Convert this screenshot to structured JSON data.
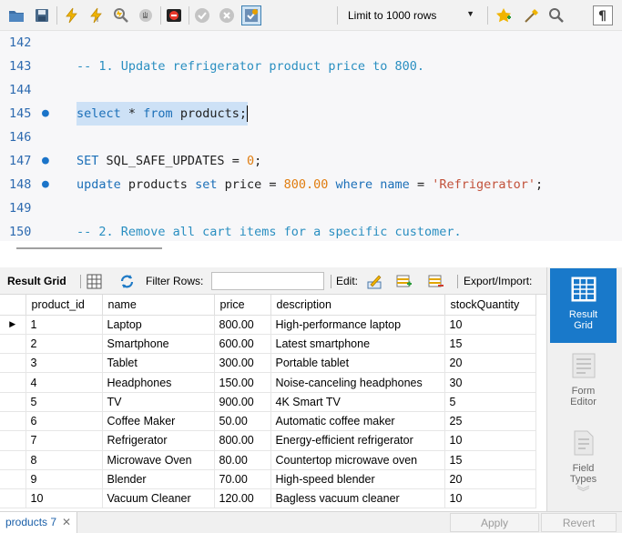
{
  "toolbar": {
    "icons": [
      "open-folder-icon",
      "save-icon",
      "execute-icon",
      "execute-selection-icon",
      "explain-icon",
      "stop-icon",
      "toggle-error-icon",
      "commit-icon",
      "rollback-icon",
      "autocommit-icon",
      "add-snippet-icon",
      "beautify-icon",
      "find-icon",
      "invisible-chars-icon"
    ],
    "limit_label": "Limit to 1000 rows"
  },
  "editor": {
    "lines": [
      {
        "num": "142",
        "dot": false,
        "html_parts": []
      },
      {
        "num": "143",
        "dot": false,
        "comment": "-- 1. Update refrigerator product price to 800."
      },
      {
        "num": "144",
        "dot": false
      },
      {
        "num": "145",
        "dot": true,
        "kw1": "select",
        "op": " * ",
        "kw2": "from",
        "rest": " products;"
      },
      {
        "num": "146",
        "dot": false
      },
      {
        "num": "147",
        "dot": true,
        "kw1": "SET",
        "rest": " SQL_SAFE_UPDATES = ",
        "num_val": "0",
        "end": ";"
      },
      {
        "num": "148",
        "dot": true,
        "kw1": "update",
        "t1": " products ",
        "kw2": "set",
        "t2": " price = ",
        "num_val": "800.00",
        "kw3": " where ",
        "kw4": "name",
        "t3": " = ",
        "str_val": "'Refrigerator'",
        "end": ";"
      },
      {
        "num": "149",
        "dot": false
      },
      {
        "num": "150",
        "dot": false,
        "comment": "-- 2. Remove all cart items for a specific customer."
      }
    ]
  },
  "results_toolbar": {
    "tab_label": "Result Grid",
    "filter_label": "Filter Rows:",
    "filter_value": "",
    "edit_label": "Edit:",
    "export_label": "Export/Import:"
  },
  "grid": {
    "columns": [
      "product_id",
      "name",
      "price",
      "description",
      "stockQuantity"
    ],
    "rows": [
      [
        "1",
        "Laptop",
        "800.00",
        "High-performance laptop",
        "10"
      ],
      [
        "2",
        "Smartphone",
        "600.00",
        "Latest smartphone",
        "15"
      ],
      [
        "3",
        "Tablet",
        "300.00",
        "Portable tablet",
        "20"
      ],
      [
        "4",
        "Headphones",
        "150.00",
        "Noise-canceling headphones",
        "30"
      ],
      [
        "5",
        "TV",
        "900.00",
        "4K Smart TV",
        "5"
      ],
      [
        "6",
        "Coffee Maker",
        "50.00",
        "Automatic coffee maker",
        "25"
      ],
      [
        "7",
        "Refrigerator",
        "800.00",
        "Energy-efficient refrigerator",
        "10"
      ],
      [
        "8",
        "Microwave Oven",
        "80.00",
        "Countertop microwave oven",
        "15"
      ],
      [
        "9",
        "Blender",
        "70.00",
        "High-speed blender",
        "20"
      ],
      [
        "10",
        "Vacuum Cleaner",
        "120.00",
        "Bagless vacuum cleaner",
        "10"
      ]
    ]
  },
  "side_panel": {
    "result_grid": {
      "line1": "Result",
      "line2": "Grid"
    },
    "form_editor": {
      "line1": "Form",
      "line2": "Editor"
    },
    "field_types": {
      "line1": "Field",
      "line2": "Types"
    }
  },
  "bottom": {
    "tab_label": "products 7",
    "apply_label": "Apply",
    "revert_label": "Revert"
  },
  "colors": {
    "accent": "#1979ca",
    "keyword": "#1b6fb8",
    "comment": "#2a8fc1",
    "number": "#e07d10",
    "string": "#c2513a",
    "selection": "#cde1f6"
  }
}
